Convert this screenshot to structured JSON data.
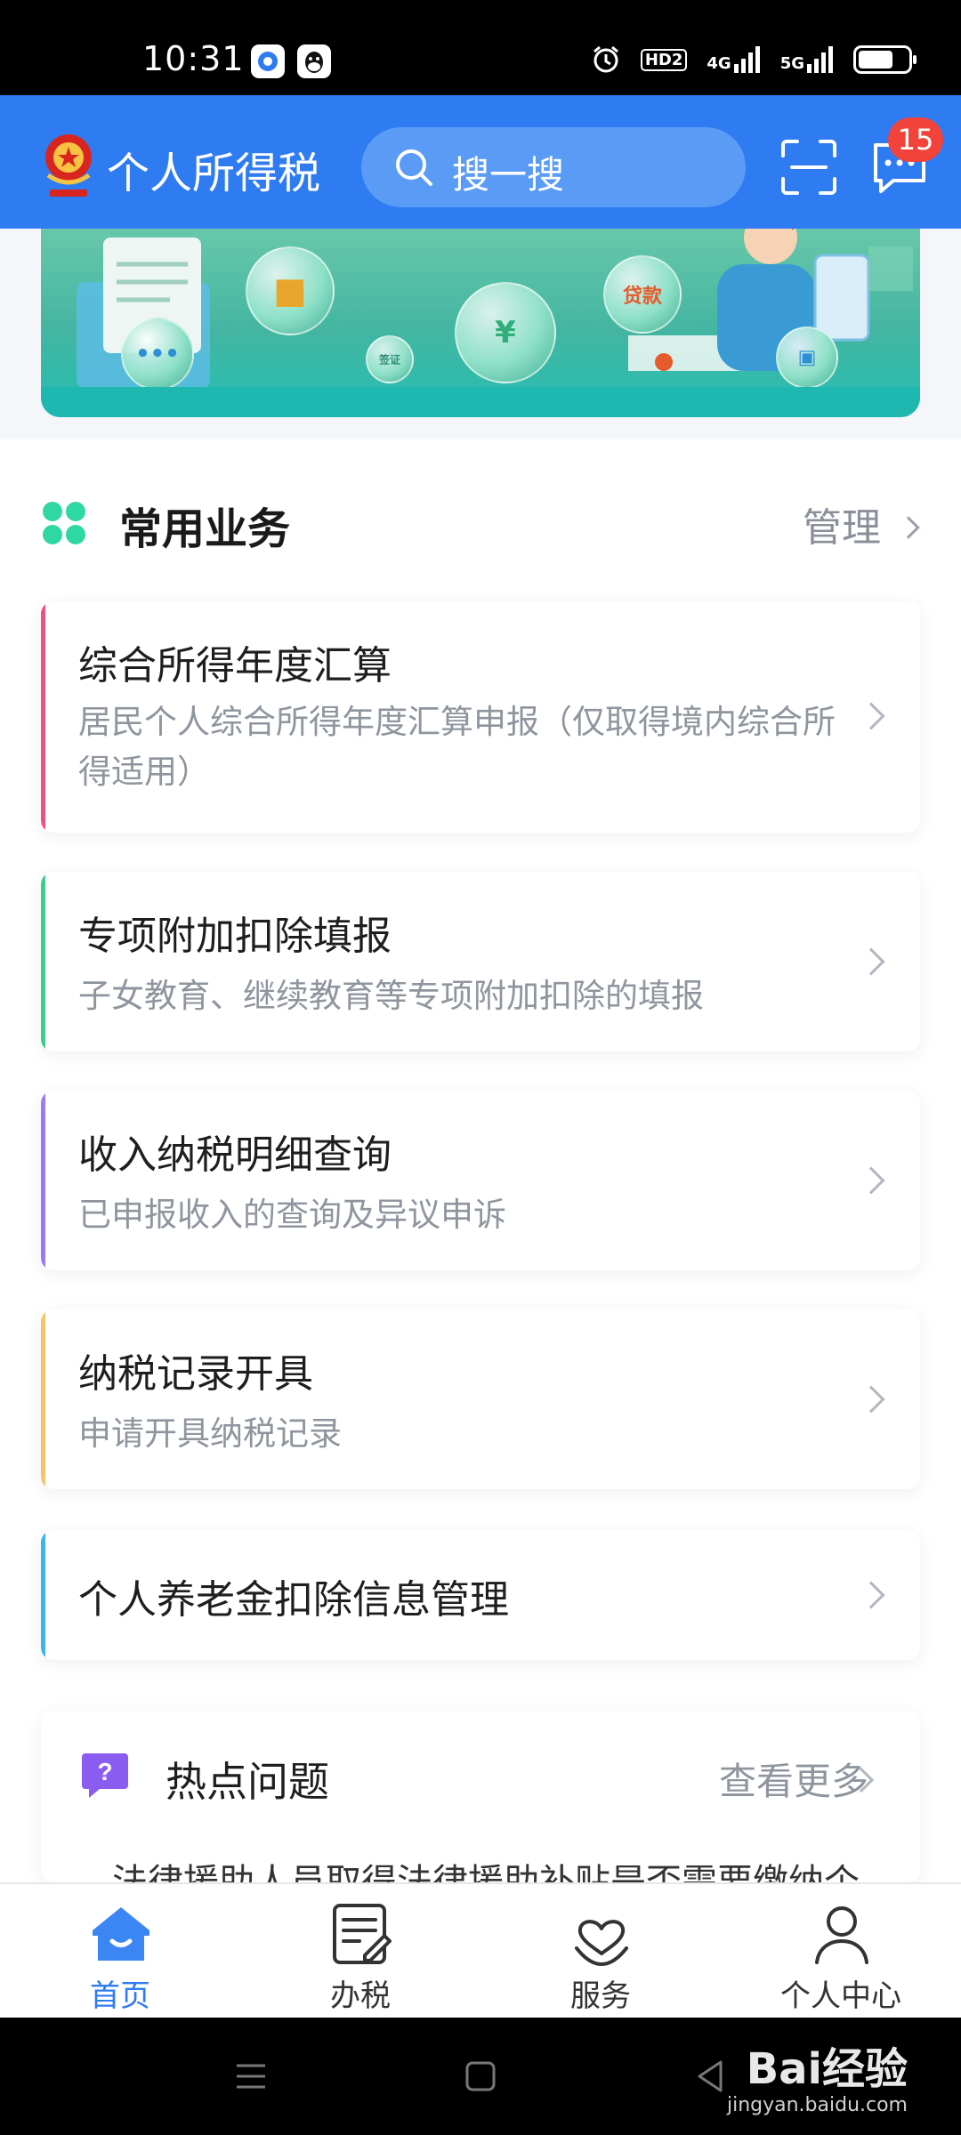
{
  "status_bar": {
    "time": "10:31",
    "network_1": "4G",
    "network_2": "5G",
    "hd_label": "HD2",
    "battery_level": 0.7
  },
  "header": {
    "app_title": "个人所得税",
    "search_placeholder": "搜一搜",
    "message_badge": "15"
  },
  "banner": {
    "bubble_loan": "贷款",
    "bubble_small": "签证"
  },
  "section": {
    "title": "常用业务",
    "manage_label": "管理"
  },
  "cards": [
    {
      "title": "综合所得年度汇算",
      "desc": "居民个人综合所得年度汇算申报（仅取得境内综合所得适用）",
      "accent": "#f0517a"
    },
    {
      "title": "专项附加扣除填报",
      "desc": "子女教育、继续教育等专项附加扣除的填报",
      "accent": "#3ccf8a"
    },
    {
      "title": "收入纳税明细查询",
      "desc": "已申报收入的查询及异议申诉",
      "accent": "#9b7cf0"
    },
    {
      "title": "纳税记录开具",
      "desc": "申请开具纳税记录",
      "accent": "#f6c36a"
    },
    {
      "title": "个人养老金扣除信息管理",
      "desc": "",
      "accent": "#3cb4f0"
    }
  ],
  "hot_questions": {
    "title": "热点问题",
    "more_label": "查看更多",
    "peek_text": "法律援助人员取得法律援助补贴是否需要缴纳个"
  },
  "tabbar": [
    {
      "label": "首页",
      "icon": "home-icon",
      "active": true
    },
    {
      "label": "办税",
      "icon": "document-edit-icon",
      "active": false
    },
    {
      "label": "服务",
      "icon": "heart-hand-icon",
      "active": false
    },
    {
      "label": "个人中心",
      "icon": "user-icon",
      "active": false
    }
  ],
  "watermark": {
    "brand": "Bai经验",
    "url": "jingyan.baidu.com"
  },
  "colors": {
    "primary": "#2f7bf2",
    "badge": "#f2433b",
    "section_icon": "#2fd7a3"
  }
}
